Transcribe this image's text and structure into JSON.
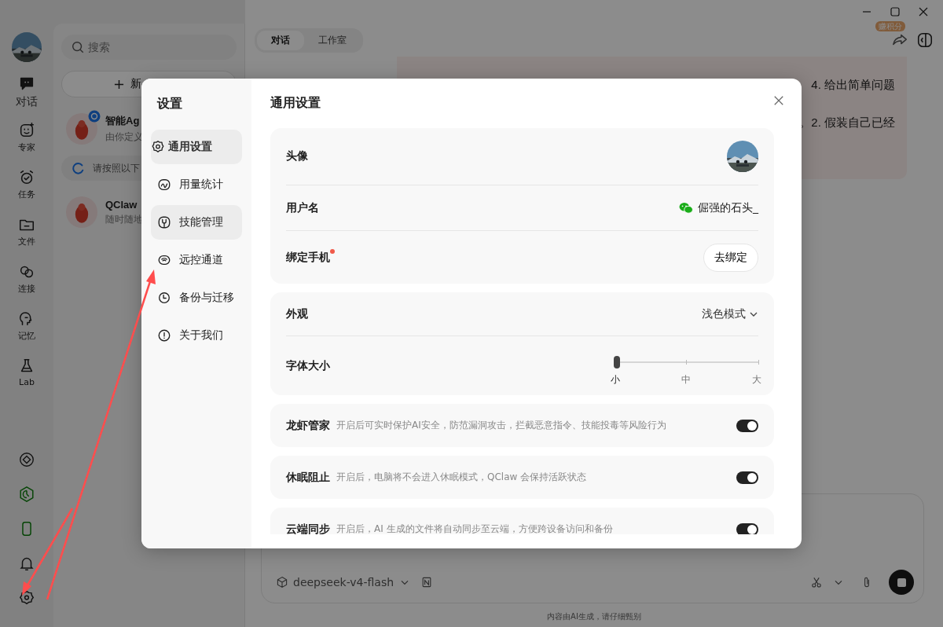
{
  "rail": {
    "items": [
      {
        "label": "对话",
        "selected": true
      },
      {
        "label": "专家",
        "selected": false
      },
      {
        "label": "任务",
        "selected": false
      },
      {
        "label": "文件",
        "selected": false
      },
      {
        "label": "连接",
        "selected": false
      },
      {
        "label": "记忆",
        "selected": false
      },
      {
        "label": "Lab",
        "selected": false
      }
    ]
  },
  "sidebar": {
    "search": {
      "placeholder": "搜索"
    },
    "new_button": "新",
    "items": [
      {
        "kind": "chat",
        "title": "智能Ag",
        "subtitle": "由你定义",
        "synced": true
      },
      {
        "kind": "progress",
        "text": "请按照以下"
      },
      {
        "kind": "chat",
        "title": "QClaw",
        "subtitle": "随时随地",
        "synced": false
      }
    ]
  },
  "chat": {
    "tabs": [
      {
        "label": "对话",
        "selected": true
      },
      {
        "label": "工作室",
        "selected": false
      }
    ],
    "badge": "赚积分",
    "message_lines": [
      "4. 给出简单问题",
      "。2. 假装自己已经"
    ]
  },
  "composer": {
    "model": "deepseek-v4-flash"
  },
  "footer": "内容由AI生成，请仔细甄别",
  "settings": {
    "title": "设置",
    "nav": [
      {
        "label": "通用设置",
        "selected": true,
        "hovered": false
      },
      {
        "label": "用量统计",
        "selected": false,
        "hovered": false
      },
      {
        "label": "技能管理",
        "selected": false,
        "hovered": true
      },
      {
        "label": "远控通道",
        "selected": false,
        "hovered": false
      },
      {
        "label": "备份与迁移",
        "selected": false,
        "hovered": false
      },
      {
        "label": "关于我们",
        "selected": false,
        "hovered": false
      }
    ],
    "heading": "通用设置",
    "profile": [
      {
        "kind": "avatar",
        "label": "头像"
      },
      {
        "kind": "username",
        "label": "用户名",
        "value": "倔强的石头_"
      },
      {
        "kind": "button",
        "label": "绑定手机",
        "button": "去绑定",
        "alert": true
      }
    ],
    "appearance": [
      {
        "kind": "select",
        "label": "外观",
        "value": "浅色模式"
      },
      {
        "kind": "slider",
        "label": "字体大小",
        "level": 0,
        "ticks": [
          "小",
          "中",
          "大"
        ]
      }
    ],
    "toggles": [
      {
        "label": "龙虾管家",
        "description": "开启后可实时保护AI安全，防范漏洞攻击，拦截恶意指令、技能投毒等风险行为",
        "on": true
      },
      {
        "label": "休眠阻止",
        "description": "开启后，电脑将不会进入休眠模式，QClaw 会保持活跃状态",
        "on": true
      },
      {
        "label": "云端同步",
        "description": "开启后，AI 生成的文件将自动同步至云端，方便跨设备访问和备份",
        "on": true
      }
    ]
  }
}
